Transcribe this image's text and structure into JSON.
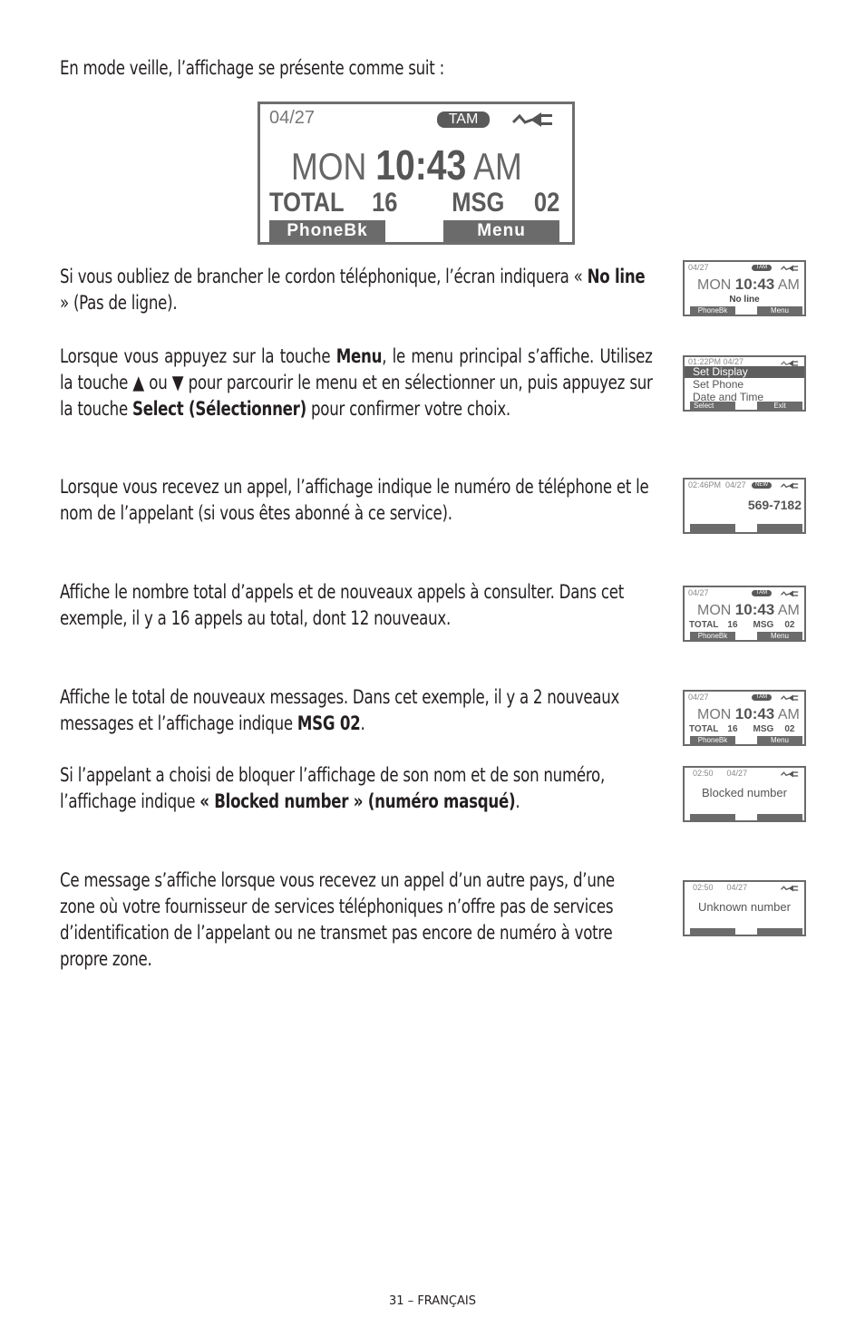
{
  "intro": "En mode veille, l’affichage se présente comme suit :",
  "main_lcd": {
    "date": "04/27",
    "tam_badge": "TAM",
    "icon": "line-plug-icon",
    "day": "MON",
    "time": "10:43",
    "ampm": "AM",
    "total_label": "TOTAL",
    "total_value": "16",
    "msg_label": "MSG",
    "msg_value": "02",
    "softkey_left": "PhoneBk",
    "softkey_right": "Menu"
  },
  "sections": [
    {
      "segments": [
        {
          "text": "Si vous oubliez de brancher le cordon téléphonique, l’écran indiquera « ",
          "bold": false
        },
        {
          "text": "No line",
          "bold": true
        },
        {
          "text": " » (Pas de ligne).",
          "bold": false
        }
      ],
      "lcd": {
        "type": "standby-noline",
        "date": "04/27",
        "tam_badge": "TAM",
        "day": "MON",
        "time": "10:43",
        "ampm": "AM",
        "message": "No line",
        "softkey_left": "PhoneBk",
        "softkey_right": "Menu"
      }
    },
    {
      "segments": [
        {
          "text": "Lorsque vous appuyez sur la touche ",
          "bold": false
        },
        {
          "text": "Menu",
          "bold": true
        },
        {
          "text": ", le menu principal s’affiche. Utilisez la touche ▲ ou ▼ pour parcourir le menu et en sélectionner un, puis appuyez sur la touche ",
          "bold": false
        },
        {
          "text": "Select (Sélectionner)",
          "bold": true
        },
        {
          "text": " pour confirmer votre choix.",
          "bold": false
        }
      ],
      "lcd": {
        "type": "menu",
        "header": "01:22PM 04/27",
        "items": [
          "Set Display",
          "Set Phone",
          "Date and Time"
        ],
        "selected_index": 0,
        "softkey_left": "Select",
        "softkey_right": "Exit"
      }
    },
    {
      "segments": [
        {
          "text": "Lorsque vous recevez un appel, l’affichage indique le numéro de téléphone et le nom de l’appelant (si vous êtes abonné à ce service).",
          "bold": false
        }
      ],
      "lcd": {
        "type": "incoming",
        "time": "02:46PM",
        "date": "04/27",
        "new_badge": "NEW",
        "number": "569-7182"
      }
    },
    {
      "segments": [
        {
          "text": "Affiche le nombre total d’appels et de nouveaux appels à consulter. Dans cet exemple, il y a 16 appels au total, dont 12 nouveaux.",
          "bold": false
        }
      ],
      "lcd": {
        "type": "standby",
        "date": "04/27",
        "tam_badge": "TAM",
        "day": "MON",
        "time": "10:43",
        "ampm": "AM",
        "total_label": "TOTAL",
        "total_value": "16",
        "msg_label": "MSG",
        "msg_value": "02",
        "softkey_left": "PhoneBk",
        "softkey_right": "Menu"
      }
    },
    {
      "segments": [
        {
          "text": "Affiche le total de nouveaux messages. Dans cet exemple, il y a 2 nouveaux messages et l’affichage indique ",
          "bold": false
        },
        {
          "text": "MSG 02",
          "bold": true
        },
        {
          "text": ".",
          "bold": false
        }
      ],
      "lcd": {
        "type": "standby",
        "date": "04/27",
        "tam_badge": "TAM",
        "day": "MON",
        "time": "10:43",
        "ampm": "AM",
        "total_label": "TOTAL",
        "total_value": "16",
        "msg_label": "MSG",
        "msg_value": "02",
        "softkey_left": "PhoneBk",
        "softkey_right": "Menu"
      }
    },
    {
      "segments": [
        {
          "text": "Si l’appelant a choisi de bloquer l’affichage de son nom et de son numéro, l’affichage indique ",
          "bold": false
        },
        {
          "text": "« Blocked number » (numéro masqué)",
          "bold": true
        },
        {
          "text": ".",
          "bold": false
        }
      ],
      "lcd": {
        "type": "caller-message",
        "time": "02:50",
        "date": "04/27",
        "message": "Blocked number"
      }
    },
    {
      "segments": [
        {
          "text": "Ce message s’affiche lorsque vous recevez un appel d’un autre pays, d’une zone où votre fournisseur de services téléphoniques n’offre pas de services d’identification de l’appelant ou ne transmet pas encore de numéro à votre propre zone.",
          "bold": false
        }
      ],
      "lcd": {
        "type": "caller-message",
        "time": "02:50",
        "date": "04/27",
        "message": "Unknown number"
      }
    }
  ],
  "footer": {
    "page_label": "31 – FRANÇAIS"
  }
}
